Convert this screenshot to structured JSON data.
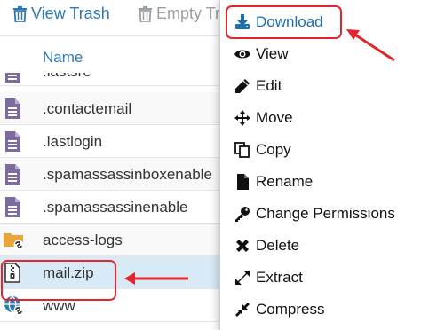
{
  "toolbar": {
    "view_trash": "View Trash",
    "empty_trash": "Empty Tr"
  },
  "list": {
    "column_name": "Name",
    "rows": [
      {
        "name": ".lastsre",
        "icon": "file-icon"
      },
      {
        "name": ".contactemail",
        "icon": "file-icon"
      },
      {
        "name": ".lastlogin",
        "icon": "file-icon"
      },
      {
        "name": ".spamassassinboxenable",
        "icon": "file-icon"
      },
      {
        "name": ".spamassassinenable",
        "icon": "file-icon"
      },
      {
        "name": "access-logs",
        "icon": "folder-link-icon"
      },
      {
        "name": "mail.zip",
        "icon": "zip-file-icon",
        "selected": true
      },
      {
        "name": "www",
        "icon": "globe-link-icon"
      }
    ]
  },
  "context_menu": {
    "items": [
      {
        "label": "Download",
        "icon": "download-icon"
      },
      {
        "label": "View",
        "icon": "eye-icon"
      },
      {
        "label": "Edit",
        "icon": "pencil-icon"
      },
      {
        "label": "Move",
        "icon": "move-icon"
      },
      {
        "label": "Copy",
        "icon": "copy-icon"
      },
      {
        "label": "Rename",
        "icon": "file-icon"
      },
      {
        "label": "Change Permissions",
        "icon": "key-icon"
      },
      {
        "label": "Delete",
        "icon": "x-icon"
      },
      {
        "label": "Extract",
        "icon": "expand-icon"
      },
      {
        "label": "Compress",
        "icon": "compress-icon"
      }
    ]
  },
  "colors": {
    "link_blue": "#2e7ab8",
    "callout_red": "#e3262b",
    "file_icon_purple": "#7d6ba0",
    "selected_row": "#d9eaf7"
  }
}
